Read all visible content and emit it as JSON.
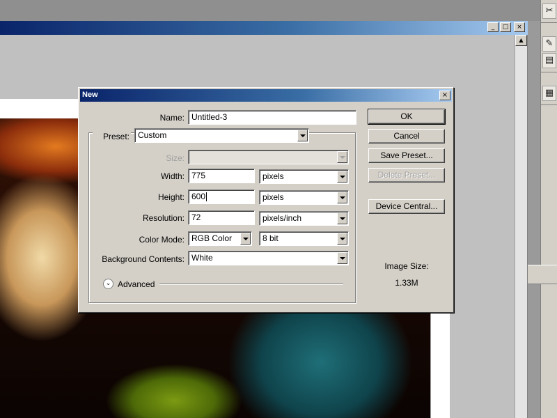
{
  "dialog": {
    "title": "New",
    "name_label": "Name:",
    "name_value": "Untitled-3",
    "preset_label": "Preset:",
    "preset_value": "Custom",
    "size_label": "Size:",
    "size_value": "",
    "width_label": "Width:",
    "width_value": "775",
    "width_unit": "pixels",
    "height_label": "Height:",
    "height_value": "600",
    "height_unit": "pixels",
    "resolution_label": "Resolution:",
    "resolution_value": "72",
    "resolution_unit": "pixels/inch",
    "color_mode_label": "Color Mode:",
    "color_mode_value": "RGB Color",
    "bit_depth_value": "8 bit",
    "background_label": "Background Contents:",
    "background_value": "White",
    "advanced_label": "Advanced",
    "image_size_label": "Image Size:",
    "image_size_value": "1.33M",
    "buttons": {
      "ok": "OK",
      "cancel": "Cancel",
      "save_preset": "Save Preset...",
      "delete_preset": "Delete Preset...",
      "device_central": "Device Central..."
    }
  },
  "window_controls": {
    "minimize": "_",
    "maximize": "□",
    "close": "×"
  },
  "icons": {
    "palette": [
      "tools-icon",
      "brush-icon",
      "stamp-icon",
      "layers-icon"
    ]
  },
  "colors": {
    "titlebar_start": "#0a246a",
    "titlebar_end": "#a6caf0",
    "dialog_face": "#d4d0c8"
  }
}
